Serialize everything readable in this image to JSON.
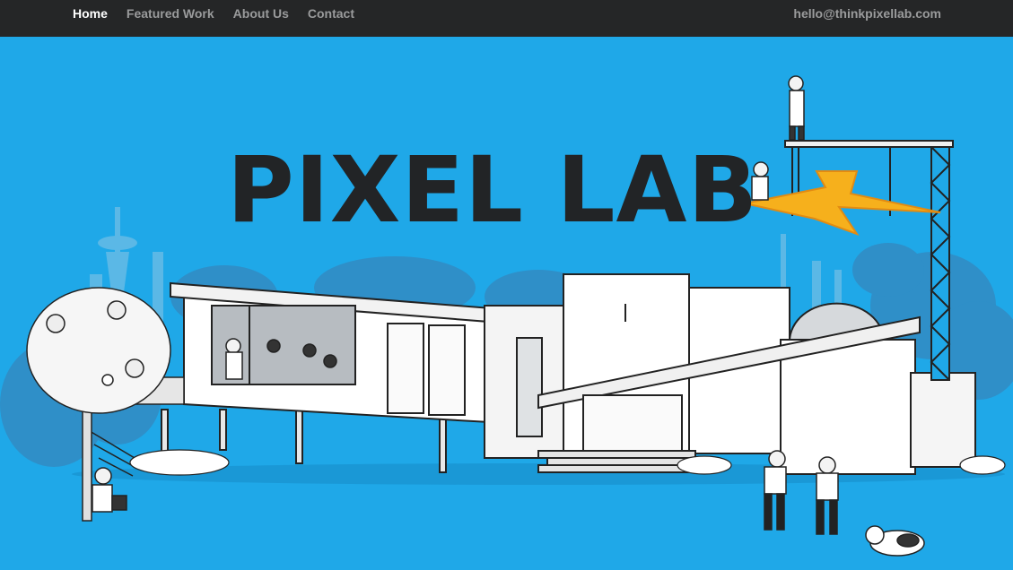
{
  "nav": {
    "items": [
      {
        "label": "Home",
        "active": true
      },
      {
        "label": "Featured Work",
        "active": false
      },
      {
        "label": "About Us",
        "active": false
      },
      {
        "label": "Contact",
        "active": false
      }
    ],
    "email": "hello@thinkpixellab.com"
  },
  "hero": {
    "logo": "PIXEL LAB"
  },
  "colors": {
    "topbar": "#252627",
    "hero_background": "#1fa8e8",
    "logo": "#222426",
    "nav_active": "#ffffff",
    "nav_inactive": "#9a9b9c"
  }
}
